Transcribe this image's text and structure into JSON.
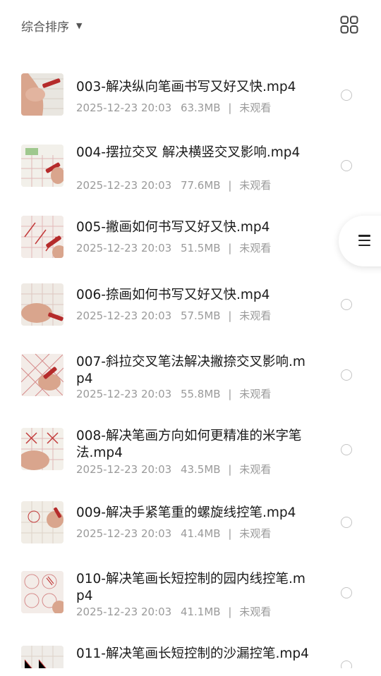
{
  "header": {
    "sort_label": "综合排序",
    "sort_icon": "caret-down-icon",
    "view_toggle_icon": "grid-view-icon"
  },
  "files": [
    {
      "title": "003-解决纵向笔画书写又好又快.mp4",
      "date": "2025-12-23 20:03",
      "size": "63.3MB",
      "status": "未观看"
    },
    {
      "title": "004-摆拉交叉  解决横竖交叉影响.mp4",
      "date": "2025-12-23 20:03",
      "size": "77.6MB",
      "status": "未观看"
    },
    {
      "title": "005-撇画如何书写又好又快.mp4",
      "date": "2025-12-23 20:03",
      "size": "51.5MB",
      "status": "未观看"
    },
    {
      "title": "006-捺画如何书写又好又快.mp4",
      "date": "2025-12-23 20:03",
      "size": "57.5MB",
      "status": "未观看"
    },
    {
      "title": "007-斜拉交叉笔法解决撇捺交叉影响.mp4",
      "date": "2025-12-23 20:03",
      "size": "55.8MB",
      "status": "未观看"
    },
    {
      "title": "008-解决笔画方向如何更精准的米字笔法.mp4",
      "date": "2025-12-23 20:03",
      "size": "43.5MB",
      "status": "未观看"
    },
    {
      "title": "009-解决手紧笔重的螺旋线控笔.mp4",
      "date": "2025-12-23 20:03",
      "size": "41.4MB",
      "status": "未观看"
    },
    {
      "title": "010-解决笔画长短控制的园内线控笔.mp4",
      "date": "2025-12-23 20:03",
      "size": "41.1MB",
      "status": "未观看"
    },
    {
      "title": "011-解决笔画长短控制的沙漏控笔.mp4",
      "date": "",
      "size": "",
      "status": ""
    }
  ],
  "separator": "|",
  "floating_menu_icon": "menu-icon"
}
